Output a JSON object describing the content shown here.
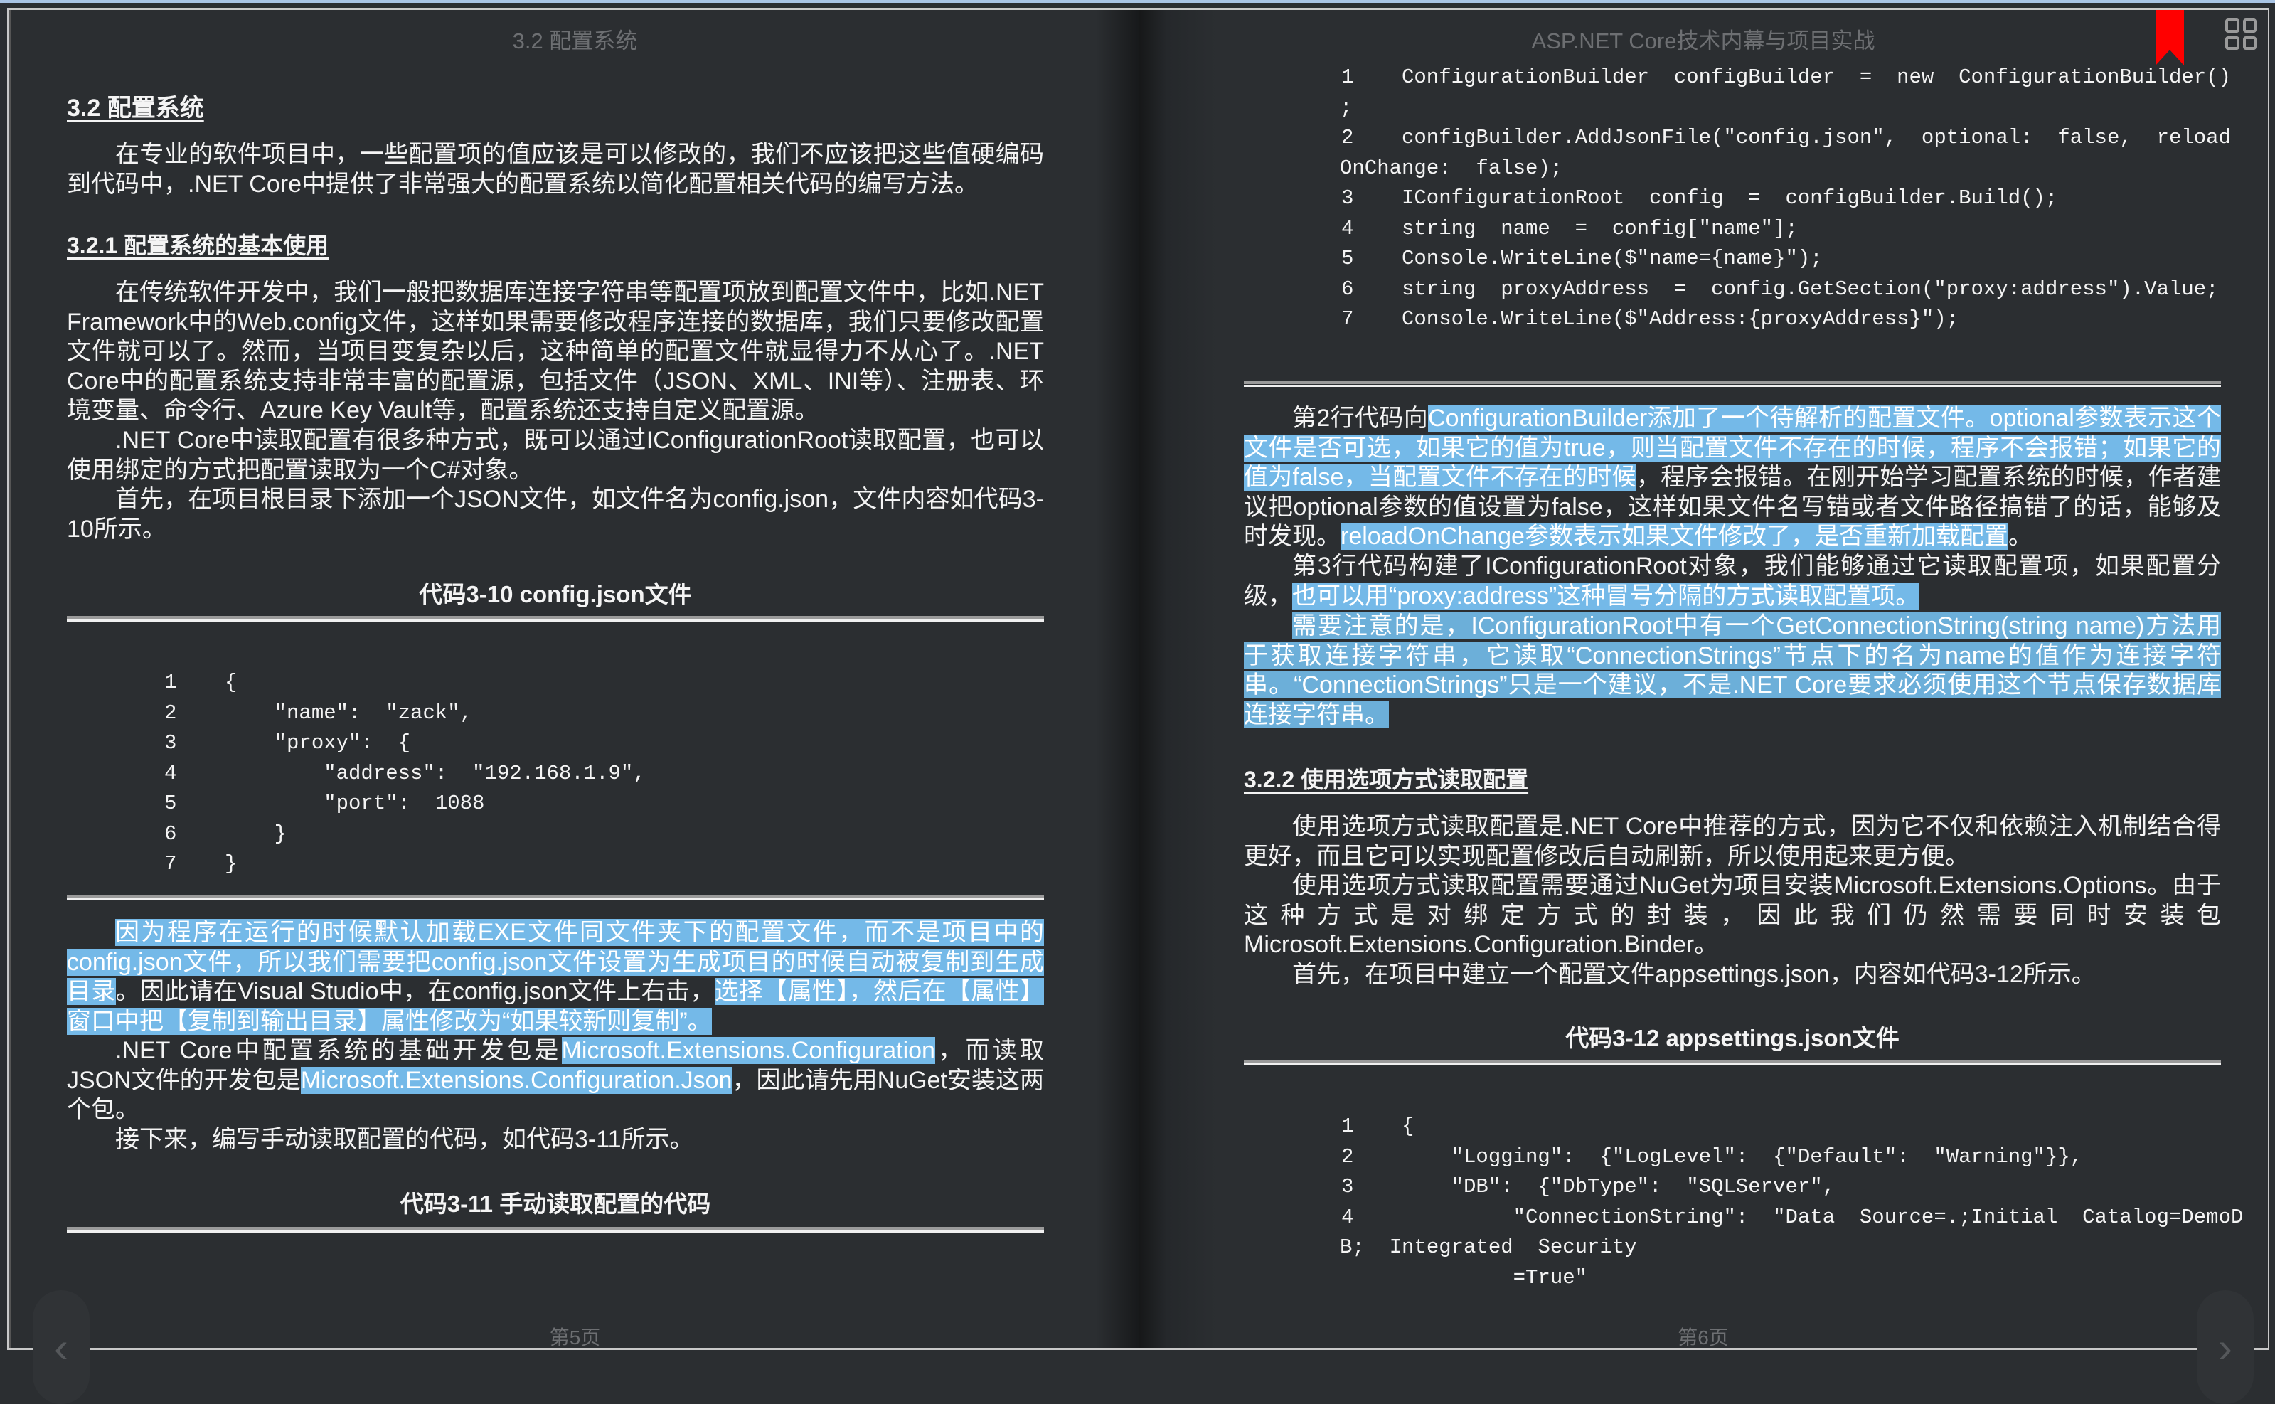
{
  "colors": {
    "highlight": "#74b9e8",
    "bookmark": "#ff0000",
    "background": "#2b2e31"
  },
  "left": {
    "running_header": "3.2 配置系统",
    "h1": "3.2 配置系统",
    "p1": [
      {
        "t": "在专业的软件项目中，一些配置项的值应该是可以修改的，我们不应该把这些值硬编码到代码中，.NET Core中提供了非常强大的配置系统以简化配置相关代码的编写方法。"
      }
    ],
    "h2": "3.2.1 配置系统的基本使用",
    "p2": [
      {
        "t": "在传统软件开发中，我们一般把数据库连接字符串等配置项放到配置文件中，比如.NET Framework中的Web.config文件，这样如果需要修改程序连接的数据库，我们只要修改配置文件就可以了。然而，当项目变复杂以后，这种简单的配置文件就显得力不从心了。.NET Core中的配置系统支持非常丰富的配置源，包括文件（JSON、XML、INI等）、注册表、环境变量、命令行、Azure Key Vault等，配置系统还支持自定义配置源。"
      }
    ],
    "p3": [
      {
        "t": ".NET Core中读取配置有很多种方式，既可以通过IConfigurationRoot读取配置，也可以使用绑定的方式把配置读取为一个C#对象。"
      }
    ],
    "p4": [
      {
        "t": "首先，在项目根目录下添加一个JSON文件，如文件名为config.json，文件内容如代码3-10所示。"
      }
    ],
    "caption1": "代码3-10 config.json文件",
    "code1": [
      {
        "n": "1",
        "c": "{"
      },
      {
        "n": "2",
        "c": "    \"name\":  \"zack\","
      },
      {
        "n": "3",
        "c": "    \"proxy\":  {"
      },
      {
        "n": "4",
        "c": "        \"address\":  \"192.168.1.9\","
      },
      {
        "n": "5",
        "c": "        \"port\":  1088"
      },
      {
        "n": "6",
        "c": "    }"
      },
      {
        "n": "7",
        "c": "}"
      }
    ],
    "p5": [
      {
        "t": "因为程序在运行的时候默认加载EXE文件同文件夹下的配置文件，而不是项目中的config.json文件，所以我们需要把config.json文件设置为生成项目的时候自动被复制到生成目录",
        "hl": 1
      },
      {
        "t": "。因此请在Visual Studio中，在config.json文件上右击，"
      },
      {
        "t": "选择【属性】，然后在【属性】窗口中把【复制到输出目录】属性修改为“如果较新则复制”。",
        "hl": 1
      }
    ],
    "p6": [
      {
        "t": ".NET Core中配置系统的基础开发包是"
      },
      {
        "t": "Microsoft.Extensions.Configuration",
        "hl": 1
      },
      {
        "t": "，而读取JSON文件的开发包是"
      },
      {
        "t": "Microsoft.Extensions.Configuration.Json",
        "hl": 1
      },
      {
        "t": "，因此请先用NuGet安装这两个包。"
      }
    ],
    "p7": [
      {
        "t": "接下来，编写手动读取配置的代码，如代码3-11所示。"
      }
    ],
    "caption2": "代码3-11 手动读取配置的代码",
    "footer": "第5页"
  },
  "right": {
    "running_header": "ASP.NET Core技术内幕与项目实战",
    "code1": [
      {
        "n": "1",
        "c": "ConfigurationBuilder  configBuilder  =  new  ConfigurationBuilder()"
      },
      {
        "n": "",
        "c": ";"
      },
      {
        "n": "2",
        "c": "configBuilder.AddJsonFile(\"config.json\",  optional:  false,  reload"
      },
      {
        "n": "",
        "c": "OnChange:  false);"
      },
      {
        "n": "3",
        "c": "IConfigurationRoot  config  =  configBuilder.Build();"
      },
      {
        "n": "4",
        "c": "string  name  =  config[\"name\"];"
      },
      {
        "n": "5",
        "c": "Console.WriteLine($\"name={name}\");"
      },
      {
        "n": "6",
        "c": "string  proxyAddress  =  config.GetSection(\"proxy:address\").Value;"
      },
      {
        "n": "7",
        "c": "Console.WriteLine($\"Address:{proxyAddress}\");"
      }
    ],
    "p1": [
      {
        "t": "第2行代码向"
      },
      {
        "t": "ConfigurationBuilder添加了一个待解析的配置文件。optional参数表示这个文件是否可选，如果它的值为true，则当配置文件不存在的时候，程序不会报错；如果它的值为false，当配置文件不存在的时候",
        "hl": 1
      },
      {
        "t": "，程序会报错。在刚开始学习配置系统的时候，作者建议把optional参数的值设置为false，这样如果文件名写错或者文件路径搞错了的话，能够及时发现。"
      },
      {
        "t": "reloadOnChange参数表示如果文件修改了，是否重新加载配置",
        "hl": 1
      },
      {
        "t": "。"
      }
    ],
    "p2": [
      {
        "t": "第3行代码构建了IConfigurationRoot对象，我们能够通过它读取配置项，如果配置分级，"
      },
      {
        "t": "也可以用“proxy:address”这种冒号分隔的方式读取配置项。",
        "hl": 1
      }
    ],
    "p3": [
      {
        "t": "需要注意的是，IConfigurationRoot中有一个GetConnectionString(string name)方法用于获取连接字符串，它读取“ConnectionStrings”节点下的名为name的值作为连接字符串。“ConnectionStrings”只是一个建议，不是.NET Core要求必须使用这个节点保存数据库连接字符串。",
        "hl": 2
      }
    ],
    "h2": "3.2.2 使用选项方式读取配置",
    "p4": [
      {
        "t": "使用选项方式读取配置是.NET Core中推荐的方式，因为它不仅和依赖注入机制结合得更好，而且它可以实现配置修改后自动刷新，所以使用起来更方便。"
      }
    ],
    "p5": [
      {
        "t": "使用选项方式读取配置需要通过NuGet为项目安装Microsoft.Extensions.Options。由于这种方式是对绑定方式的封装，因此我们仍然需要同时安装包Microsoft.Extensions.Configuration.Binder。"
      }
    ],
    "p6": [
      {
        "t": "首先，在项目中建立一个配置文件appsettings.json，内容如代码3-12所示。"
      }
    ],
    "caption": "代码3-12 appsettings.json文件",
    "code2": [
      {
        "n": "1",
        "c": "{"
      },
      {
        "n": "2",
        "c": "    \"Logging\":  {\"LogLevel\":  {\"Default\":  \"Warning\"}},"
      },
      {
        "n": "3",
        "c": "    \"DB\":  {\"DbType\":  \"SQLServer\","
      },
      {
        "n": "4",
        "c": "         \"ConnectionString\":  \"Data  Source=.;Initial  Catalog=DemoD"
      },
      {
        "n": "",
        "c": "B;  Integrated  Security"
      },
      {
        "n": "",
        "c": "              =True\""
      }
    ],
    "footer": "第6页"
  },
  "icons": {
    "prev": "chevron-left-icon",
    "next": "chevron-right-icon",
    "bookmark": "bookmark-icon",
    "grid": "grid-view-icon"
  },
  "nav": {
    "prev": "‹",
    "next": "›"
  }
}
